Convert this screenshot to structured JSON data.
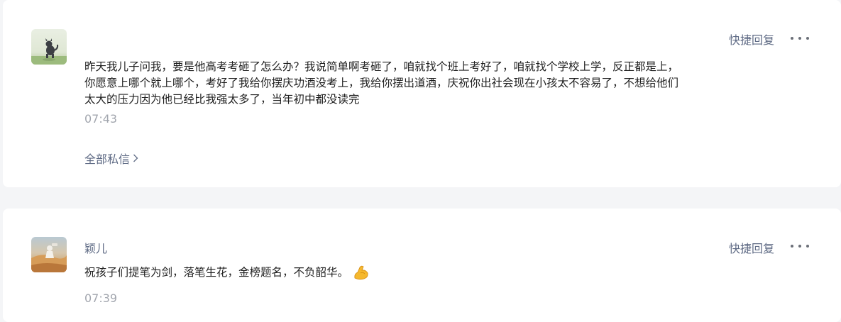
{
  "messages": [
    {
      "quick_reply_label": "快捷回复",
      "more_icon": "more-dots-icon",
      "text_lines": [
        "昨天我儿子问我，要是他高考考砸了怎么办？我说简单啊考砸了，咱就找个班上考好了，咱就找个学校上学，反正都是上，",
        "你愿意上哪个就上哪个，考好了我给你摆庆功酒没考上，我给你摆出道酒，庆祝你出社会现在小孩太不容易了，不想给他们",
        "太大的压力因为他已经比我强太多了，当年初中都没读完"
      ],
      "time": "07:43",
      "all_messages_label": "全部私信",
      "chevron_icon": "chevron-right-icon"
    },
    {
      "sender_name": "颖儿",
      "quick_reply_label": "快捷回复",
      "more_icon": "more-dots-icon",
      "text": "祝孩子们提笔为剑，落笔生花，金榜题名，不负韶华。",
      "emoji_icon": "flexed-biceps-icon",
      "time": "07:39"
    }
  ],
  "colors": {
    "link": "#5f6b85",
    "text": "#1f1f1f",
    "time": "#a2a6ae",
    "background": "#f4f5f7",
    "card": "#ffffff"
  }
}
